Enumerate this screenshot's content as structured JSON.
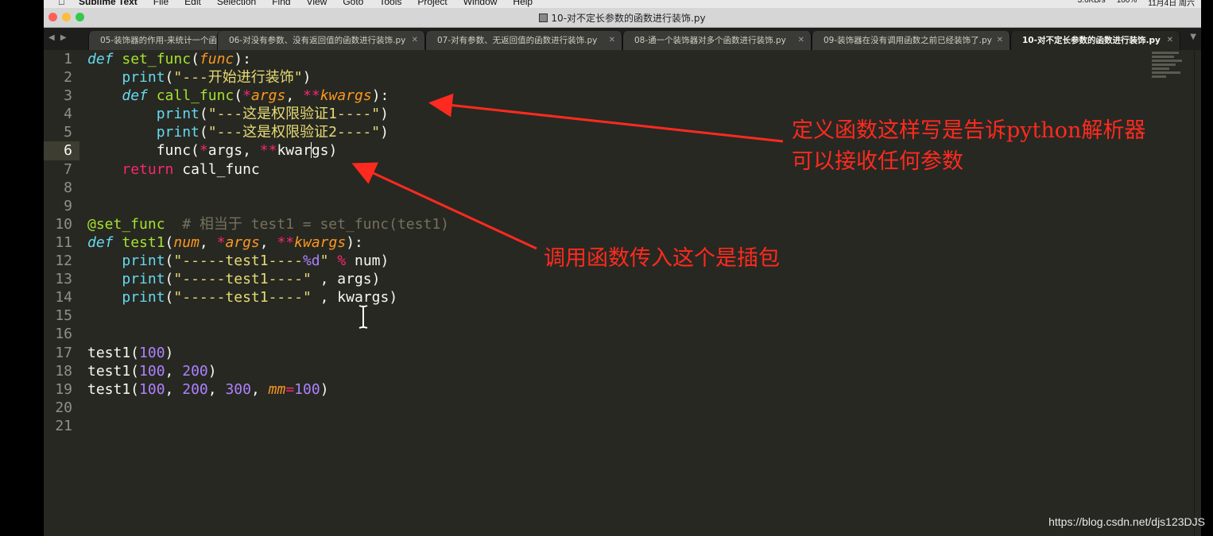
{
  "menubar": {
    "app_name": "Sublime Text",
    "menus": [
      "File",
      "Edit",
      "Selection",
      "Find",
      "View",
      "Goto",
      "Tools",
      "Project",
      "Window",
      "Help"
    ],
    "net_speed": "3.6KB/s",
    "battery": "100%",
    "date": "11月4日 周六"
  },
  "window": {
    "title": "10-对不定长参数的函数进行装饰.py"
  },
  "tabs": [
    {
      "label": "05-装饰器的作用-来统计一个函",
      "active": false
    },
    {
      "label": "06-对没有参数、没有返回值的函数进行装饰.py",
      "active": false
    },
    {
      "label": "07-对有参数、无返回值的函数进行装饰.py",
      "active": false
    },
    {
      "label": "08-通一个装饰器对多个函数进行装饰.py",
      "active": false
    },
    {
      "label": "09-装饰器在没有调用函数之前已经装饰了.py",
      "active": false
    },
    {
      "label": "10-对不定长参数的函数进行装饰.py",
      "active": true
    }
  ],
  "editor": {
    "active_line": 6,
    "line_count": 21
  },
  "annotations": {
    "top_line1": "定义函数这样写是告诉python解析器",
    "top_line2": "可以接收任何参数",
    "bottom": "调用函数传入这个是插包"
  },
  "watermark": "https://blog.csdn.net/djs123DJS",
  "colors": {
    "editor_bg": "#272822",
    "annotation_red": "#ff2a1f",
    "keyword": "#66d9ef",
    "function": "#a6e22e",
    "param": "#fd971f",
    "operator": "#f92672",
    "string": "#e6db74",
    "number": "#ae81ff",
    "comment": "#75715e"
  }
}
